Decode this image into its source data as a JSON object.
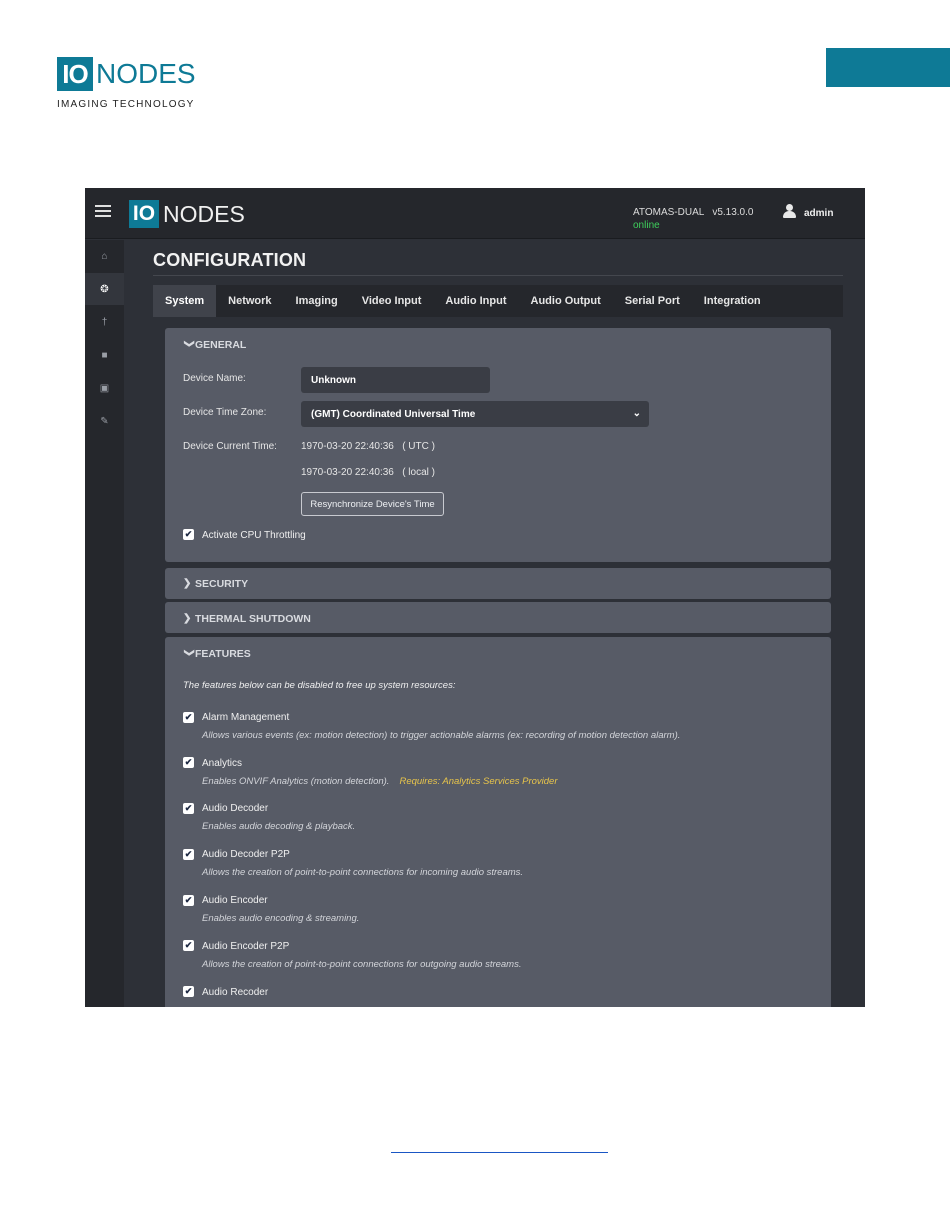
{
  "document": {
    "logo_io": "IO",
    "logo_nodes": "NODES",
    "tagline": "IMAGING TECHNOLOGY",
    "accent_color": "#0e7a96"
  },
  "app": {
    "logo_io": "IO",
    "logo_nodes": "NODES",
    "device_model": "ATOMAS-DUAL",
    "version": "v5.13.0.0",
    "status": "online",
    "user": "admin"
  },
  "sidebar": {
    "items": [
      {
        "name": "home-icon",
        "glyph": "⌂"
      },
      {
        "name": "gear-icon",
        "glyph": "✲"
      },
      {
        "name": "usb-icon",
        "glyph": "⚲"
      },
      {
        "name": "camera-icon",
        "glyph": "■"
      },
      {
        "name": "lock-icon",
        "glyph": "🔒"
      },
      {
        "name": "wrench-icon",
        "glyph": "✎"
      }
    ]
  },
  "page": {
    "title": "CONFIGURATION",
    "tabs": [
      "System",
      "Network",
      "Imaging",
      "Video Input",
      "Audio Input",
      "Audio Output",
      "Serial Port",
      "Integration"
    ]
  },
  "general": {
    "title": "GENERAL",
    "device_name_label": "Device Name:",
    "device_name_value": "Unknown",
    "timezone_label": "Device Time Zone:",
    "timezone_value": "(GMT) Coordinated Universal Time",
    "current_time_label": "Device Current Time:",
    "utc_time": "1970-03-20 22:40:36   ( UTC )",
    "local_time": "1970-03-20 22:40:36   ( local )",
    "resync_button": "Resynchronize Device's Time",
    "cpu_throttling_label": "Activate CPU Throttling"
  },
  "security": {
    "title": "SECURITY"
  },
  "thermal": {
    "title": "THERMAL SHUTDOWN"
  },
  "features": {
    "title": "FEATURES",
    "intro": "The features below can be disabled to free up system resources:",
    "items": [
      {
        "label": "Alarm Management",
        "desc": "Allows various events (ex: motion detection) to trigger actionable alarms (ex: recording of motion detection alarm).",
        "req": ""
      },
      {
        "label": "Analytics",
        "desc": "Enables ONVIF Analytics (motion detection).",
        "req": "Requires: Analytics Services Provider"
      },
      {
        "label": "Audio Decoder",
        "desc": "Enables audio decoding & playback.",
        "req": ""
      },
      {
        "label": "Audio Decoder P2P",
        "desc": "Allows the creation of point-to-point connections for incoming audio streams.",
        "req": ""
      },
      {
        "label": "Audio Encoder",
        "desc": "Enables audio encoding & streaming.",
        "req": ""
      },
      {
        "label": "Audio Encoder P2P",
        "desc": "Allows the creation of point-to-point connections for outgoing audio streams.",
        "req": ""
      },
      {
        "label": "Audio Recoder",
        "desc": "",
        "req": ""
      }
    ]
  }
}
